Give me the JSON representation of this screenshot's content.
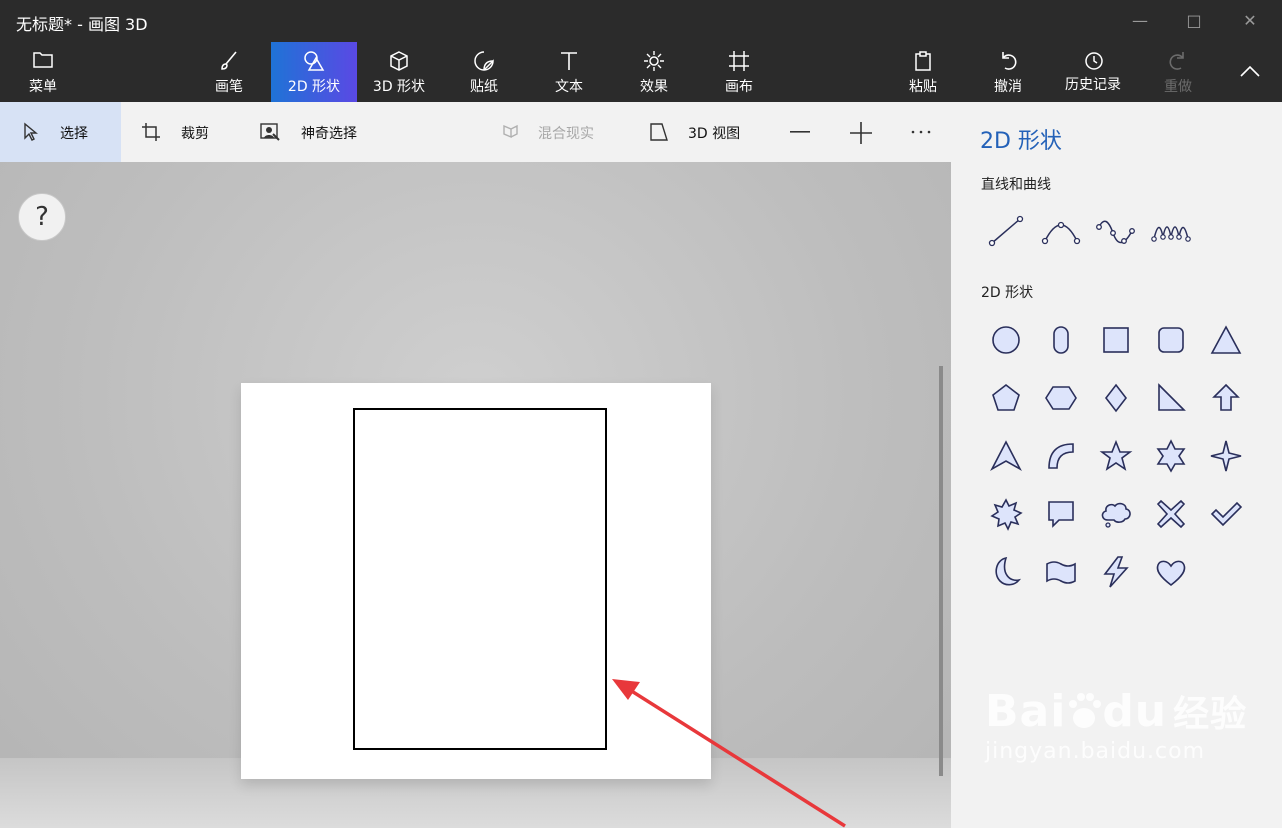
{
  "window": {
    "title": "无标题* - 画图 3D"
  },
  "ribbon": {
    "menu": "菜单",
    "brushes": "画笔",
    "shapes2d": "2D 形状",
    "shapes3d": "3D 形状",
    "stickers": "贴纸",
    "text": "文本",
    "effects": "效果",
    "canvas": "画布",
    "paste": "粘贴",
    "undo": "撤消",
    "history": "历史记录",
    "redo": "重做"
  },
  "toolbar": {
    "select": "选择",
    "crop": "裁剪",
    "magic_select": "神奇选择",
    "mixed_reality": "混合现实",
    "view3d": "3D 视图"
  },
  "canvas": {
    "help": "?"
  },
  "panel": {
    "title": "2D 形状",
    "lines_heading": "直线和曲线",
    "shapes_heading": "2D 形状",
    "line_tools": [
      "line",
      "curve-1",
      "curve-2",
      "curve-3"
    ],
    "shape_tools": [
      "circle",
      "capsule",
      "square",
      "rounded-square",
      "triangle",
      "pentagon",
      "hexagon",
      "diamond",
      "right-triangle",
      "arrow-up",
      "arrow-head",
      "quarter-arc",
      "star-5",
      "star-6",
      "star-4",
      "burst",
      "speech-bubble",
      "thought-bubble",
      "cross",
      "check",
      "moon",
      "banner",
      "lightning",
      "heart"
    ]
  },
  "watermark": {
    "brand": "Bai",
    "brand2": "du",
    "cn": "经验",
    "url": "jingyan.baidu.com"
  },
  "colors": {
    "accent": "#2361b8",
    "active_tab_from": "#1f73d6",
    "active_tab_to": "#5a49e4",
    "arrow": "#e8383b"
  }
}
